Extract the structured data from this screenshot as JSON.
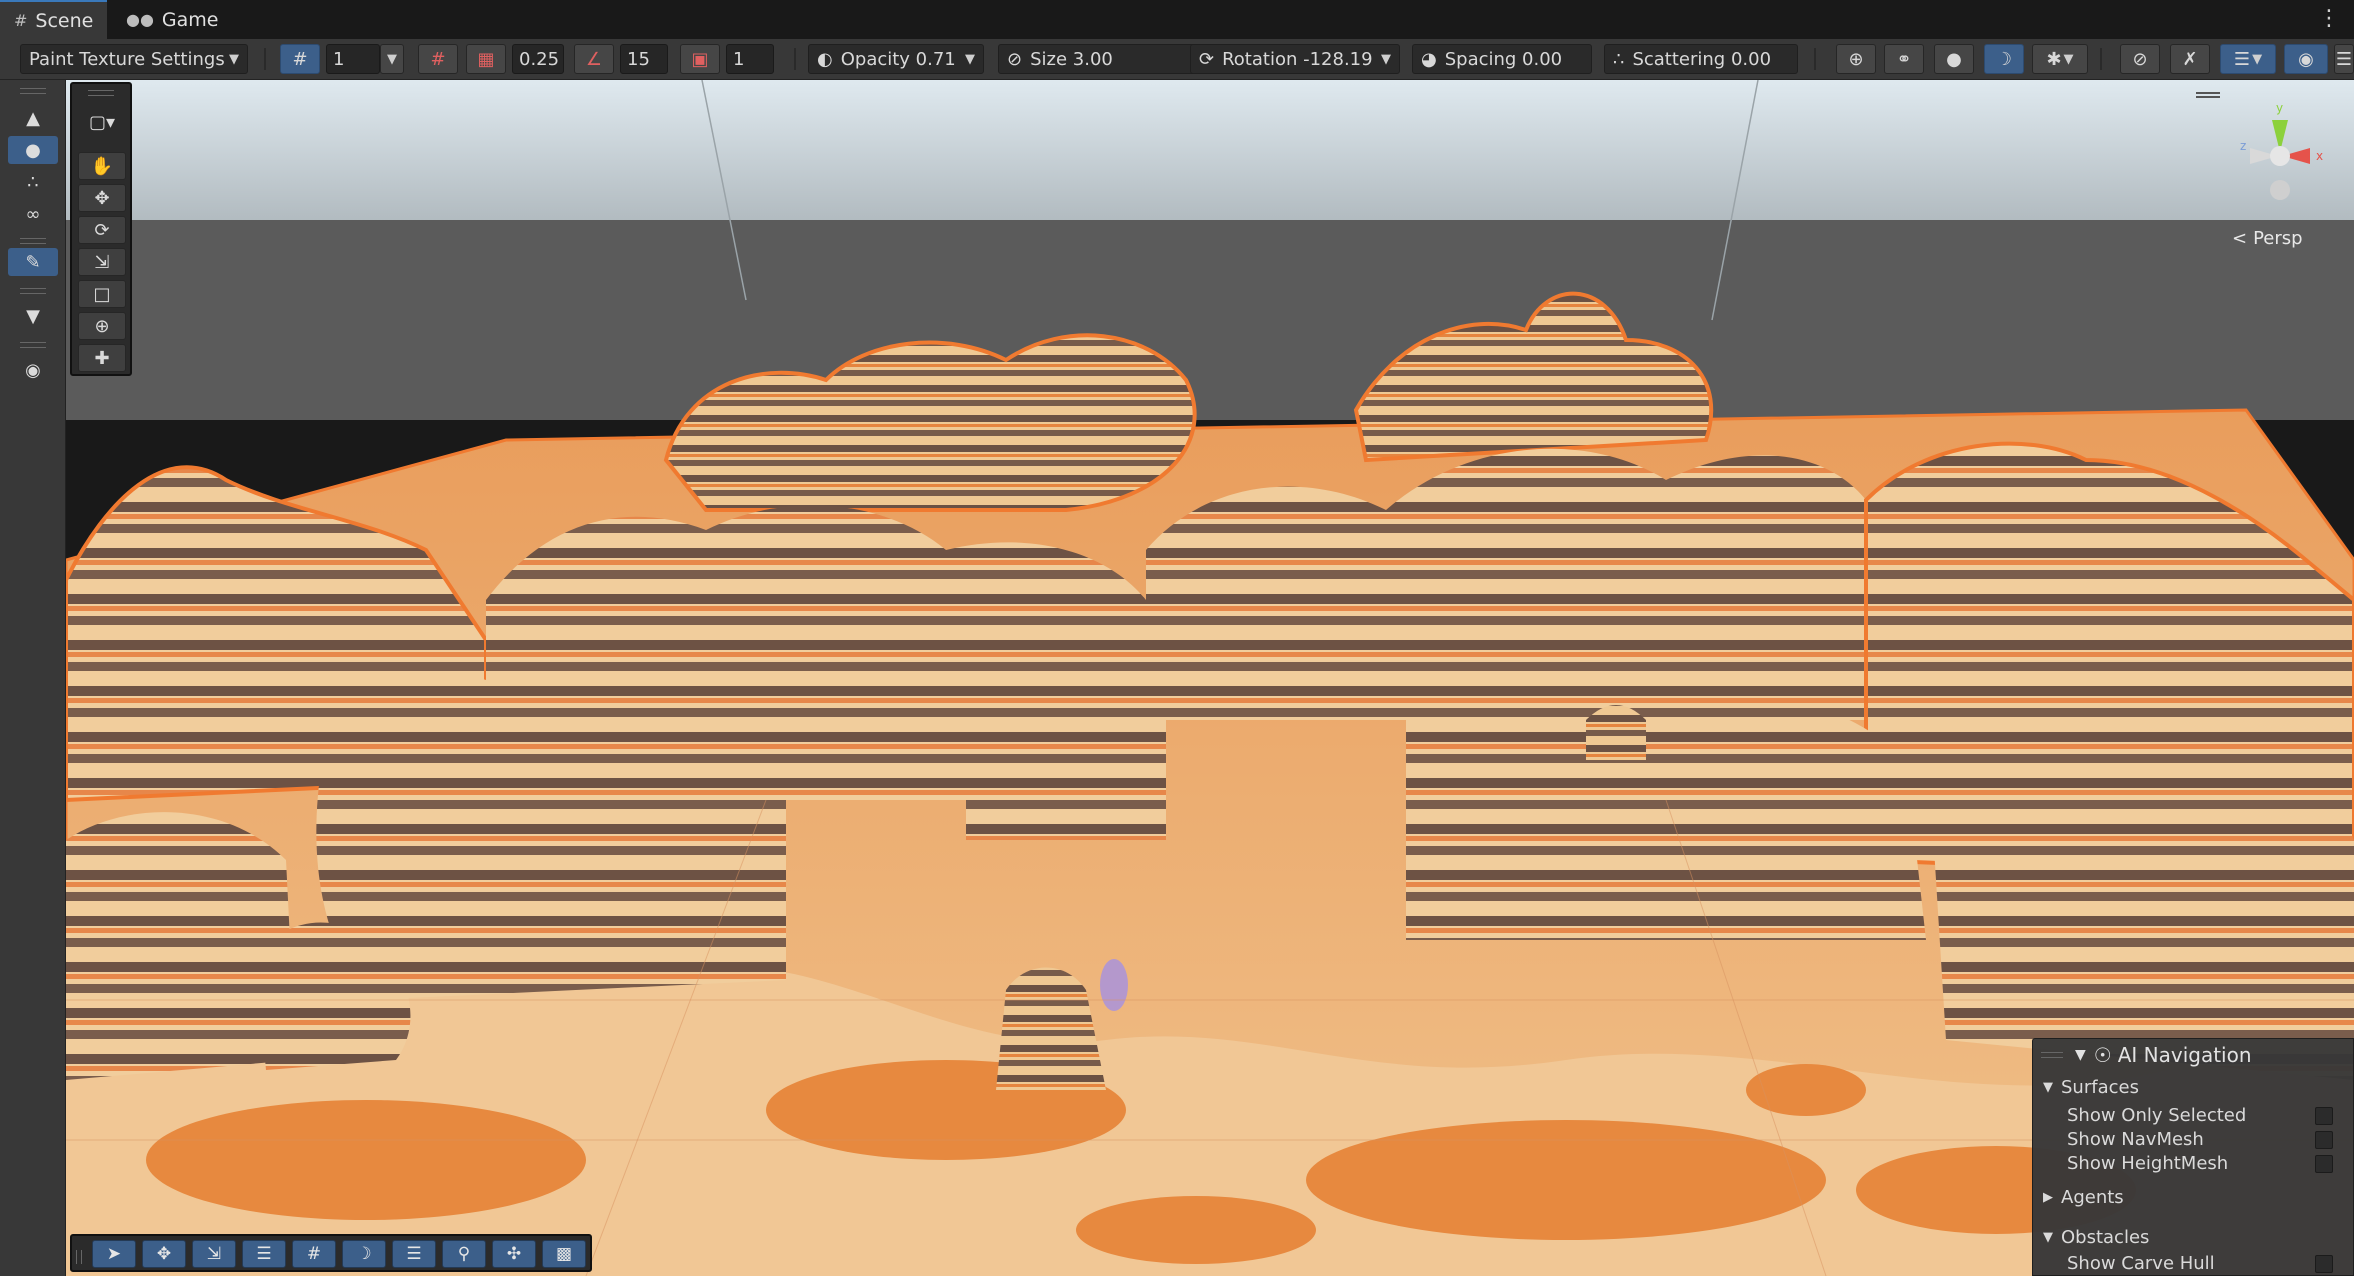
{
  "tabs": [
    {
      "label": "Scene",
      "icon": "grid-icon",
      "active": true
    },
    {
      "label": "Game",
      "icon": "gamepad-icon",
      "active": false
    }
  ],
  "toolbar": {
    "mode_dropdown": "Paint Texture Settings",
    "grid_value": "1",
    "snap_value": "0.25",
    "angle_value": "15",
    "scale_value": "1",
    "opacity": "Opacity 0.71",
    "size": "Size 3.00",
    "rotation": "Rotation -128.19",
    "spacing": "Spacing 0.00",
    "scattering": "Scattering 0.00"
  },
  "viewport": {
    "projection_label": "Persp",
    "axis_labels": {
      "x": "x",
      "y": "y",
      "z": "z"
    },
    "colors": {
      "sky_top": "#d8e5ec",
      "horizon": "#5b5b5b",
      "sand_light": "#f2c58e",
      "sand_orange": "#e48a3d",
      "rock_brown": "#6f5344",
      "outline": "#f07a30"
    }
  },
  "ai_navigation": {
    "title": "AI Navigation",
    "sections": {
      "surfaces": "Surfaces",
      "agents": "Agents",
      "obstacles": "Obstacles"
    },
    "options": {
      "show_only_selected": "Show Only Selected",
      "show_navmesh": "Show NavMesh",
      "show_heightmesh": "Show HeightMesh",
      "show_carve_hull": "Show Carve Hull"
    }
  }
}
